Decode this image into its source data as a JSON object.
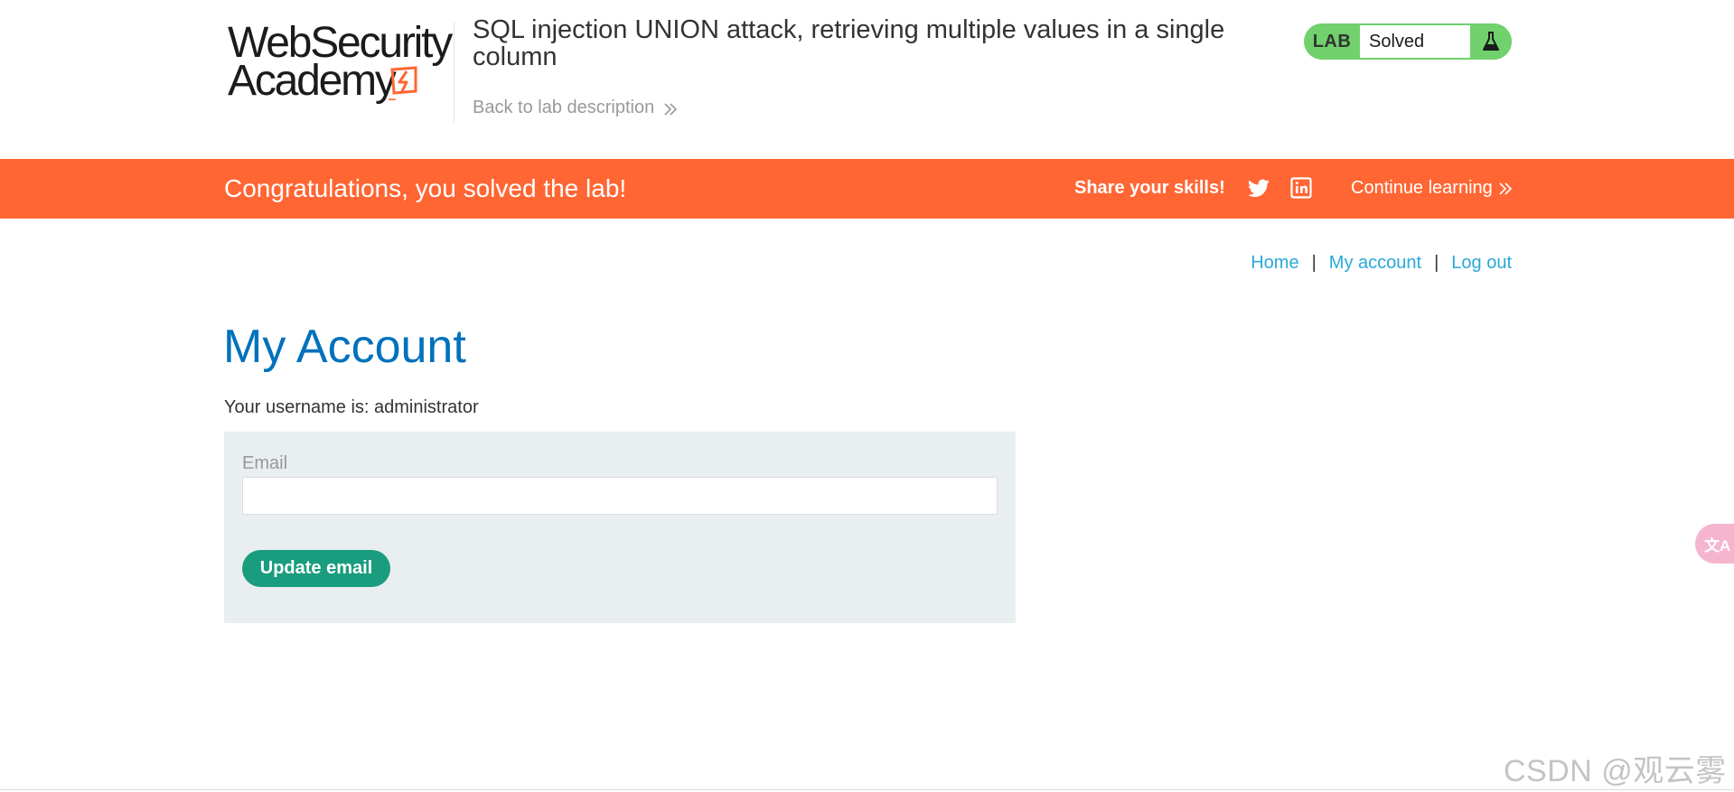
{
  "header": {
    "logo_line1": "WebSecurity",
    "logo_line2": "Academy",
    "lab_title": "SQL injection UNION attack, retrieving multiple values in a single column",
    "back_link": "Back to lab description",
    "lab_status_tag": "LAB",
    "lab_status_value": "Solved",
    "icons": {
      "back": "double-chevron-right-icon",
      "status": "flask-icon"
    }
  },
  "banner": {
    "message": "Congratulations, you solved the lab!",
    "share_label": "Share your skills!",
    "continue_label": "Continue learning",
    "icons": [
      "twitter-icon",
      "linkedin-icon",
      "double-chevron-right-icon"
    ]
  },
  "nav": {
    "home": "Home",
    "my_account": "My account",
    "log_out": "Log out",
    "separator": "|"
  },
  "main": {
    "title": "My Account",
    "username_line": "Your username is: administrator",
    "email_label": "Email",
    "email_value": "",
    "update_button": "Update email"
  },
  "extras": {
    "translate_label": "文A",
    "watermark": "CSDN @观云雾"
  },
  "colors": {
    "brand_orange": "#ff6633",
    "status_green": "#70d16d",
    "title_blue": "#0071bc",
    "link_blue": "#29a8d8",
    "button_green": "#1a9d7e",
    "form_bg": "#e9eef0"
  }
}
